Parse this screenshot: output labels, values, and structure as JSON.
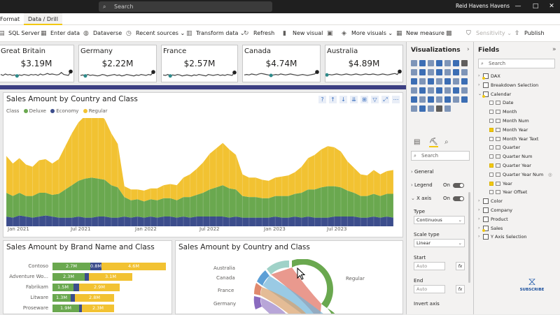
{
  "titlebar": {
    "search_placeholder": "Search",
    "user_name": "Reid Havens Havens",
    "minimize": "—",
    "maximize": "□",
    "close": "✕"
  },
  "tabs": [
    {
      "label": "Format",
      "active": false
    },
    {
      "label": "Data / Drill",
      "active": true
    }
  ],
  "ribbon": {
    "sql_server": "SQL Server",
    "enter_data": "Enter data",
    "dataverse": "Dataverse",
    "recent_sources": "Recent sources",
    "transform_data": "Transform data",
    "refresh": "Refresh",
    "new_visual": "New visual",
    "more_visuals": "More visuals",
    "new_measure": "New measure",
    "sensitivity": "Sensitivity",
    "publish": "Publish"
  },
  "kpis": [
    {
      "country": "Great Britain",
      "value": "$3.19M",
      "trend": [
        0.6,
        0.5,
        0.65,
        0.55,
        0.6,
        0.5,
        0.55,
        0.45,
        0.55,
        0.5,
        0.6,
        0.55,
        0.5,
        0.6,
        0.55,
        0.6,
        0.5,
        0.65,
        0.55,
        0.6,
        0.7,
        0.6,
        0.65,
        0.6,
        0.55,
        0.6,
        0.8,
        0.6,
        0.55,
        0.5,
        0.9
      ]
    },
    {
      "country": "Germany",
      "value": "$2.22M",
      "trend": [
        0.5,
        0.55,
        0.45,
        0.6,
        0.5,
        0.55,
        0.5,
        0.45,
        0.5,
        0.6,
        0.55,
        0.45,
        0.5,
        0.55,
        0.6,
        0.5,
        0.55,
        0.45,
        0.5,
        0.6,
        0.55,
        0.5,
        0.45,
        0.55,
        0.5,
        0.6,
        0.55,
        0.5,
        0.6,
        0.55,
        0.85
      ]
    },
    {
      "country": "France",
      "value": "$2.57M",
      "trend": [
        0.55,
        0.5,
        0.6,
        0.45,
        0.55,
        0.5,
        0.6,
        0.55,
        0.45,
        0.5,
        0.55,
        0.5,
        0.45,
        0.55,
        0.5,
        0.6,
        0.55,
        0.5,
        0.45,
        0.6,
        0.55,
        0.5,
        0.55,
        0.6,
        0.5,
        0.55,
        0.5,
        0.6,
        0.55,
        0.5,
        0.8
      ]
    },
    {
      "country": "Canada",
      "value": "$4.74M",
      "trend": [
        0.55,
        0.6,
        0.55,
        0.65,
        0.6,
        0.55,
        0.65,
        0.7,
        0.65,
        0.6,
        0.55,
        0.5,
        0.55,
        0.6,
        0.55,
        0.65,
        0.6,
        0.55,
        0.6,
        0.65,
        0.6,
        0.55,
        0.5,
        0.55,
        0.6,
        0.55,
        0.5,
        0.55,
        0.6,
        0.65,
        0.85
      ]
    },
    {
      "country": "Australia",
      "value": "$4.89M",
      "trend": [
        0.55,
        0.6,
        0.55,
        0.6,
        0.65,
        0.6,
        0.55,
        0.6,
        0.65,
        0.6,
        0.55,
        0.6,
        0.65,
        0.6,
        0.55,
        0.6,
        0.65,
        0.6,
        0.6,
        0.65,
        0.6,
        0.55,
        0.6,
        0.65,
        0.6,
        0.55,
        0.6,
        0.65,
        0.7,
        0.6,
        0.9
      ]
    }
  ],
  "main_chart": {
    "title": "Sales Amount by Country and Class",
    "legend_title": "Class",
    "legend": [
      {
        "name": "Deluxe",
        "color": "#6aa84f"
      },
      {
        "name": "Economy",
        "color": "#3c4d8c"
      },
      {
        "name": "Regular",
        "color": "#f2c232"
      }
    ],
    "x_labels": [
      "Jan 2021",
      "Jul 2021",
      "Jan 2022",
      "Jul 2022",
      "Jan 2023",
      "Jul 2023"
    ],
    "icons": [
      "?",
      "↑",
      "↓",
      "⇊",
      "⊞",
      "▽",
      "⤢",
      "⋯"
    ]
  },
  "chart_data": {
    "type": "area",
    "title": "Sales Amount by Country and Class",
    "xlabel": "",
    "ylabel": "",
    "x": [
      "Jan 2021",
      "Jul 2021",
      "Jan 2022",
      "Jul 2022",
      "Jan 2023",
      "Jul 2023"
    ],
    "stacked": true,
    "series": [
      {
        "name": "Economy",
        "values": [
          0.09,
          0.08,
          0.1,
          0.09,
          0.08,
          0.09,
          0.1,
          0.09,
          0.08,
          0.08,
          0.08,
          0.09,
          0.08,
          0.08,
          0.09,
          0.09,
          0.08,
          0.08,
          0.09,
          0.08,
          0.09,
          0.08,
          0.09,
          0.08,
          0.09,
          0.09,
          0.08,
          0.09,
          0.08,
          0.09,
          0.09,
          0.09,
          0.09,
          0.09,
          0.08,
          0.09,
          0.08,
          0.08,
          0.08,
          0.08,
          0.08,
          0.09,
          0.08,
          0.08,
          0.09,
          0.08,
          0.09,
          0.08,
          0.08,
          0.08,
          0.09,
          0.09,
          0.09,
          0.09,
          0.08,
          0.08,
          0.09,
          0.08,
          0.09,
          0.08
        ]
      },
      {
        "name": "Deluxe",
        "values": [
          0.22,
          0.2,
          0.21,
          0.19,
          0.2,
          0.22,
          0.21,
          0.2,
          0.22,
          0.26,
          0.3,
          0.33,
          0.36,
          0.37,
          0.35,
          0.34,
          0.3,
          0.28,
          0.18,
          0.16,
          0.16,
          0.15,
          0.16,
          0.16,
          0.17,
          0.17,
          0.16,
          0.18,
          0.19,
          0.2,
          0.22,
          0.25,
          0.27,
          0.29,
          0.27,
          0.25,
          0.2,
          0.19,
          0.19,
          0.18,
          0.18,
          0.19,
          0.2,
          0.2,
          0.21,
          0.23,
          0.25,
          0.26,
          0.28,
          0.29,
          0.28,
          0.27,
          0.24,
          0.22,
          0.2,
          0.2,
          0.21,
          0.2,
          0.21,
          0.22
        ]
      },
      {
        "name": "Regular",
        "values": [
          0.34,
          0.3,
          0.32,
          0.29,
          0.27,
          0.3,
          0.31,
          0.29,
          0.32,
          0.4,
          0.48,
          0.54,
          0.58,
          0.62,
          0.6,
          0.56,
          0.48,
          0.4,
          0.1,
          0.1,
          0.09,
          0.1,
          0.1,
          0.11,
          0.12,
          0.13,
          0.14,
          0.18,
          0.21,
          0.24,
          0.28,
          0.33,
          0.36,
          0.39,
          0.36,
          0.32,
          0.2,
          0.18,
          0.18,
          0.17,
          0.16,
          0.17,
          0.18,
          0.19,
          0.2,
          0.24,
          0.29,
          0.32,
          0.35,
          0.37,
          0.36,
          0.33,
          0.27,
          0.23,
          0.2,
          0.19,
          0.22,
          0.2,
          0.21,
          0.22
        ]
      }
    ]
  },
  "brand_chart": {
    "title": "Sales Amount by Brand Name and Class",
    "rows": [
      {
        "name": "Contoso",
        "segments": [
          {
            "label": "2.7M",
            "value": 2.7,
            "color": "#6aa84f"
          },
          {
            "label": "0.8M",
            "value": 0.8,
            "color": "#3c4d8c"
          },
          {
            "label": "4.6M",
            "value": 4.6,
            "color": "#f2c232"
          }
        ]
      },
      {
        "name": "Adventure Wo...",
        "segments": [
          {
            "label": "2.3M",
            "value": 2.3,
            "color": "#6aa84f"
          },
          {
            "label": "",
            "value": 0.3,
            "color": "#3c4d8c"
          },
          {
            "label": "3.1M",
            "value": 3.1,
            "color": "#f2c232"
          }
        ]
      },
      {
        "name": "Fabrikam",
        "segments": [
          {
            "label": "1.5M",
            "value": 1.5,
            "color": "#6aa84f"
          },
          {
            "label": "",
            "value": 0.4,
            "color": "#3c4d8c"
          },
          {
            "label": "2.9M",
            "value": 2.9,
            "color": "#f2c232"
          }
        ]
      },
      {
        "name": "Litware",
        "segments": [
          {
            "label": "1.3M",
            "value": 1.3,
            "color": "#6aa84f"
          },
          {
            "label": "",
            "value": 0.3,
            "color": "#3c4d8c"
          },
          {
            "label": "2.8M",
            "value": 2.8,
            "color": "#f2c232"
          }
        ]
      },
      {
        "name": "Proseware",
        "segments": [
          {
            "label": "1.9M",
            "value": 1.9,
            "color": "#6aa84f"
          },
          {
            "label": "",
            "value": 0.2,
            "color": "#3c4d8c"
          },
          {
            "label": "2.3M",
            "value": 2.3,
            "color": "#f2c232"
          }
        ]
      }
    ]
  },
  "chord_chart": {
    "title": "Sales Amount by Country and Class",
    "labels": [
      "Australia",
      "Canada",
      "France",
      "Germany",
      "Regular"
    ]
  },
  "visualizations": {
    "header": "Visualizations",
    "search_placeholder": "Search",
    "sections": {
      "general": "General",
      "legend": "Legend",
      "legend_state": "On",
      "xaxis": "X axis",
      "xaxis_state": "On",
      "type_label": "Type",
      "type_value": "Continuous",
      "scale_label": "Scale type",
      "scale_value": "Linear",
      "start_label": "Start",
      "start_value": "Auto",
      "end_label": "End",
      "end_value": "Auto",
      "invert_label": "Invert axis",
      "fx": "fx"
    }
  },
  "fields": {
    "header": "Fields",
    "search_placeholder": "Search",
    "items": [
      {
        "kind": "table",
        "expanded": false,
        "name": "DAX",
        "yellow": true
      },
      {
        "kind": "table",
        "expanded": false,
        "name": "Breakdown Selection",
        "yellow": false
      },
      {
        "kind": "table",
        "expanded": true,
        "name": "Calendar",
        "yellow": true
      },
      {
        "kind": "field",
        "name": "Date",
        "checked": false
      },
      {
        "kind": "field",
        "name": "Month",
        "checked": false
      },
      {
        "kind": "field",
        "name": "Month Num",
        "checked": false
      },
      {
        "kind": "field",
        "name": "Month Year",
        "checked": true
      },
      {
        "kind": "field",
        "name": "Month Year Text",
        "checked": false
      },
      {
        "kind": "field",
        "name": "Quarter",
        "checked": false
      },
      {
        "kind": "field",
        "name": "Quarter Num",
        "checked": false
      },
      {
        "kind": "field",
        "name": "Quarter Year",
        "checked": true
      },
      {
        "kind": "field",
        "name": "Quarter Year Num",
        "checked": false,
        "hidden": true
      },
      {
        "kind": "field",
        "name": "Year",
        "checked": true
      },
      {
        "kind": "field",
        "name": "Year Offset",
        "checked": false
      },
      {
        "kind": "table",
        "expanded": false,
        "name": "Color",
        "yellow": false
      },
      {
        "kind": "table",
        "expanded": false,
        "name": "Company",
        "yellow": false
      },
      {
        "kind": "table",
        "expanded": false,
        "name": "Product",
        "yellow": false
      },
      {
        "kind": "table",
        "expanded": false,
        "name": "Sales",
        "yellow": true
      },
      {
        "kind": "table",
        "expanded": false,
        "name": "Y Axis Selection",
        "yellow": false
      }
    ]
  },
  "watermark": {
    "text": "SUBSCRIBE"
  }
}
